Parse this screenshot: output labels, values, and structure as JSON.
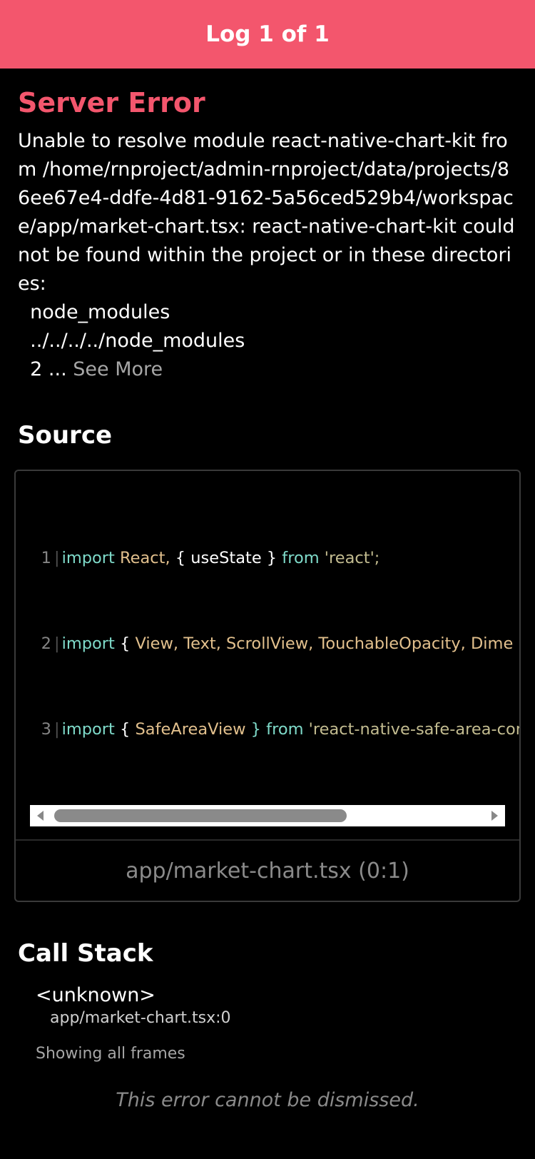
{
  "header": {
    "title": "Log 1 of 1"
  },
  "error": {
    "title": "Server Error",
    "message": "Unable to resolve module react-native-chart-kit from /home/rnproject/admin-rnproject/data/projects/86ee67e4-ddfe-4d81-9162-5a56ced529b4/workspace/app/market-chart.tsx: react-native-chart-kit could not be found within the project or in these directories:\n  node_modules\n  ../../../../node_modules\n  2 ...",
    "see_more": "See More"
  },
  "source": {
    "title": "Source",
    "lines": [
      {
        "num": "1",
        "t1": "import",
        "t2": " React,",
        "t3": " { useState }",
        "t4": " from",
        "t5": " 'react';"
      },
      {
        "num": "2",
        "t1": "import",
        "t2": " {",
        "t3": " View, Text, ScrollView, TouchableOpacity, Dime",
        "t4": "",
        "t5": ""
      },
      {
        "num": "3",
        "t1": "import",
        "t2": " {",
        "t3": " SafeAreaView",
        "t4": " } from",
        "t5": " 'react-native-safe-area-cor"
      }
    ],
    "location": "app/market-chart.tsx (0:1)"
  },
  "callstack": {
    "title": "Call Stack",
    "frames": [
      {
        "name": "<unknown>",
        "file": "app/market-chart.tsx:0"
      }
    ],
    "note": "Showing all frames"
  },
  "footer": {
    "note": "This error cannot be dismissed."
  },
  "colors": {
    "accent": "#f3566d",
    "background": "#000000"
  }
}
